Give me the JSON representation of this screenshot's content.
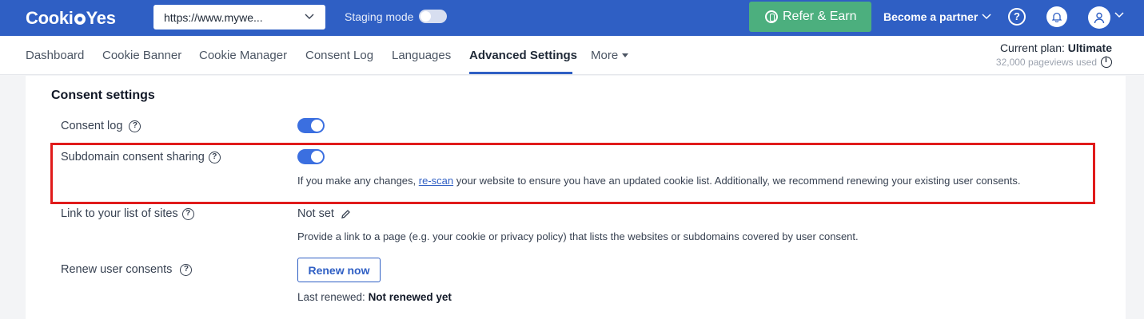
{
  "header": {
    "logo_pre": "Cooki",
    "logo_post": "Yes",
    "site_url": "https://www.mywe...",
    "staging_label": "Staging mode",
    "staging_on": false,
    "refer_label": "Refer & Earn",
    "partner_label": "Become a partner",
    "help_glyph": "?"
  },
  "nav": {
    "items": [
      {
        "label": "Dashboard",
        "active": false
      },
      {
        "label": "Cookie Banner",
        "active": false
      },
      {
        "label": "Cookie Manager",
        "active": false
      },
      {
        "label": "Consent Log",
        "active": false
      },
      {
        "label": "Languages",
        "active": false
      },
      {
        "label": "Advanced Settings",
        "active": true
      },
      {
        "label": "More",
        "active": false
      }
    ],
    "plan_prefix": "Current plan: ",
    "plan_name": "Ultimate",
    "usage": "32,000 pageviews used"
  },
  "consent": {
    "title": "Consent settings",
    "consent_log_label": "Consent log",
    "consent_log_on": true,
    "subdomain_label": "Subdomain consent sharing",
    "subdomain_on": true,
    "subdomain_desc_pre": "If you make any changes, ",
    "subdomain_desc_link": "re-scan",
    "subdomain_desc_post": " your website to ensure you have an updated cookie list. Additionally, we recommend renewing your existing user consents.",
    "sites_label": "Link to your list of sites",
    "sites_value": "Not set",
    "sites_desc": "Provide a link to a page (e.g. your cookie or privacy policy) that lists the websites or subdomains covered by user consent.",
    "renew_label": "Renew user consents",
    "renew_button": "Renew now",
    "last_renewed_label": "Last renewed: ",
    "last_renewed_value": "Not renewed yet"
  },
  "colors": {
    "brand": "#2f5fc4",
    "refer": "#4caf7e",
    "toggle_on": "#3b6fe0",
    "highlight": "#e01b1b"
  },
  "icons": [
    "chevron-down-icon",
    "coin-icon",
    "help-icon",
    "bell-icon",
    "user-icon",
    "info-icon",
    "pencil-icon"
  ]
}
